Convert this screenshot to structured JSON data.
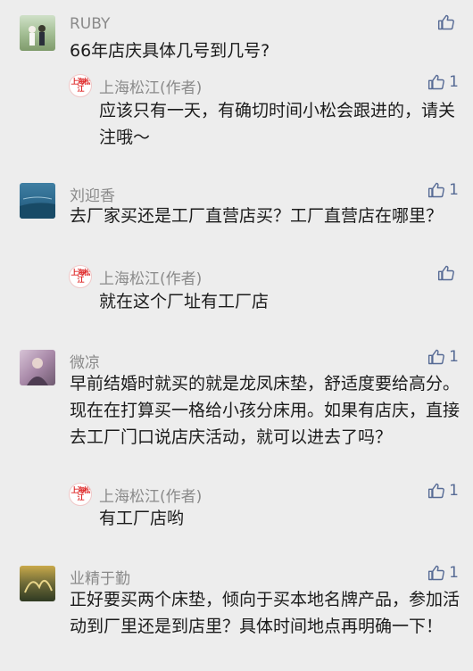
{
  "colors": {
    "background": "#ededed",
    "name": "#8a8a8a",
    "like": "#576b95",
    "author_badge": "#d22222"
  },
  "author_badge_text": "上海松江",
  "comments": [
    {
      "name": "RUBY",
      "text": "66年店庆具体几号到几号?",
      "likes": "",
      "reply": {
        "name": "上海松江(作者)",
        "text": "应该只有一天，有确切时间小松会跟进的，请关注哦～",
        "likes": "1"
      }
    },
    {
      "name": "刘迎香",
      "text": "去厂家买还是工厂直营店买？工厂直营店在哪里？",
      "likes": "1",
      "reply": {
        "name": "上海松江(作者)",
        "text": "就在这个厂址有工厂店",
        "likes": ""
      }
    },
    {
      "name": "微凉",
      "text": "早前结婚时就买的就是龙凤床垫，舒适度要给高分。现在在打算买一格给小孩分床用。如果有店庆，直接去工厂门口说店庆活动，就可以进去了吗？",
      "likes": "1",
      "reply": {
        "name": "上海松江(作者)",
        "text": "有工厂店哟",
        "likes": "1"
      }
    },
    {
      "name": "业精于勤",
      "text": "正好要买两个床垫，倾向于买本地名牌产品，参加活动到厂里还是到店里？具体时间地点再明确一下！",
      "likes": "1"
    }
  ]
}
